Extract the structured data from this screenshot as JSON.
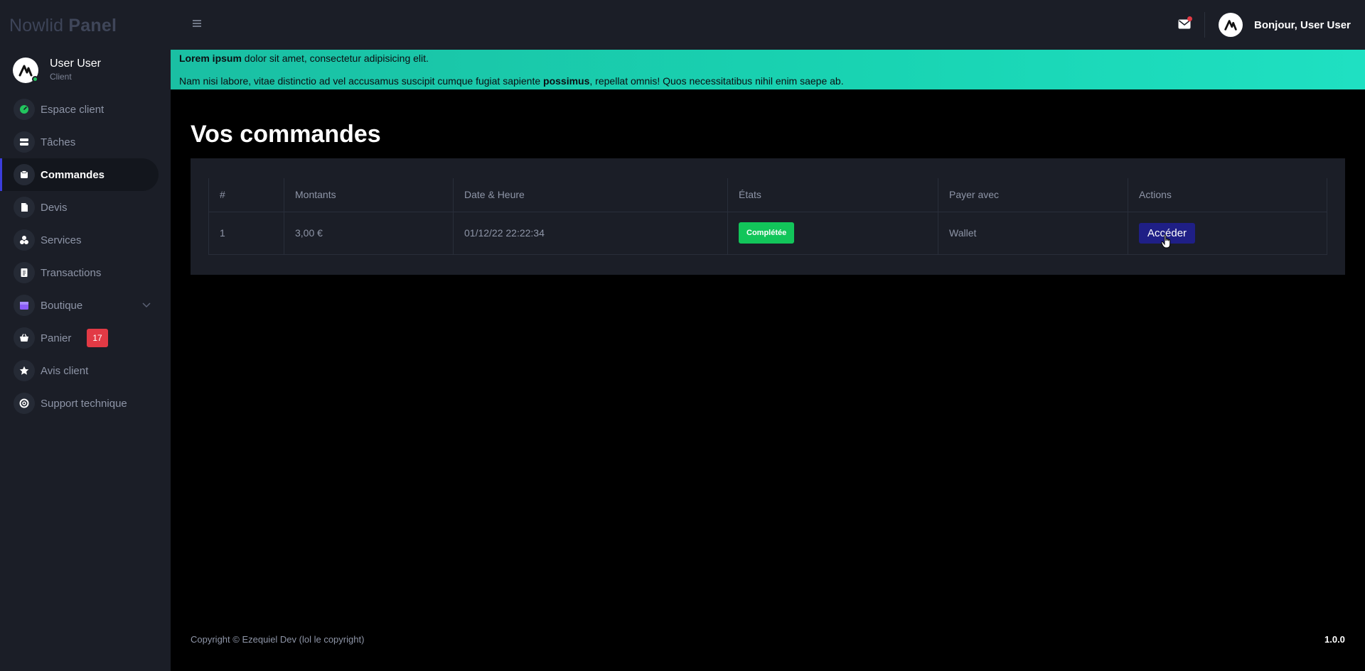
{
  "brand": {
    "part1": "Nowlid",
    "part2": "Panel"
  },
  "user": {
    "name": "User User",
    "role": "Client"
  },
  "sidebar": {
    "items": [
      {
        "label": "Espace client",
        "icon": "dashboard-icon"
      },
      {
        "label": "Tâches",
        "icon": "tasks-icon"
      },
      {
        "label": "Commandes",
        "icon": "orders-icon",
        "active": true
      },
      {
        "label": "Devis",
        "icon": "document-icon"
      },
      {
        "label": "Services",
        "icon": "services-icon"
      },
      {
        "label": "Transactions",
        "icon": "transactions-icon"
      },
      {
        "label": "Boutique",
        "icon": "store-icon"
      },
      {
        "label": "Panier",
        "icon": "cart-icon",
        "badge": "17"
      },
      {
        "label": "Avis client",
        "icon": "star-icon"
      },
      {
        "label": "Support technique",
        "icon": "support-icon"
      }
    ]
  },
  "header": {
    "greeting": "Bonjour, User User"
  },
  "alert": {
    "line1_bold": "Lorem ipsum",
    "line1_rest": " dolor sit amet, consectetur adipisicing elit.",
    "line2_start": "Nam nisi labore, vitae distinctio ad vel accusamus suscipit cumque fugiat sapiente ",
    "line2_bold": "possimus",
    "line2_end": ", repellat omnis! Quos necessitatibus nihil enim saepe ab."
  },
  "main": {
    "title": "Vos commandes",
    "table": {
      "headers": [
        "#",
        "Montants",
        "Date & Heure",
        "États",
        "Payer avec",
        "Actions"
      ],
      "rows": [
        {
          "id": "1",
          "amount": "3,00 €",
          "datetime": "01/12/22 22:22:34",
          "status": "Complétée",
          "payment": "Wallet",
          "action": "Accéder"
        }
      ]
    }
  },
  "footer": {
    "copyright": "Copyright © Ezequiel Dev (lol le copyright)",
    "version": "1.0.0"
  },
  "colors": {
    "accent": "#3b3ddb",
    "success": "#12c55a",
    "danger": "#e23a45",
    "alert_bg": "#19d4b3",
    "button": "#1f1f86"
  }
}
